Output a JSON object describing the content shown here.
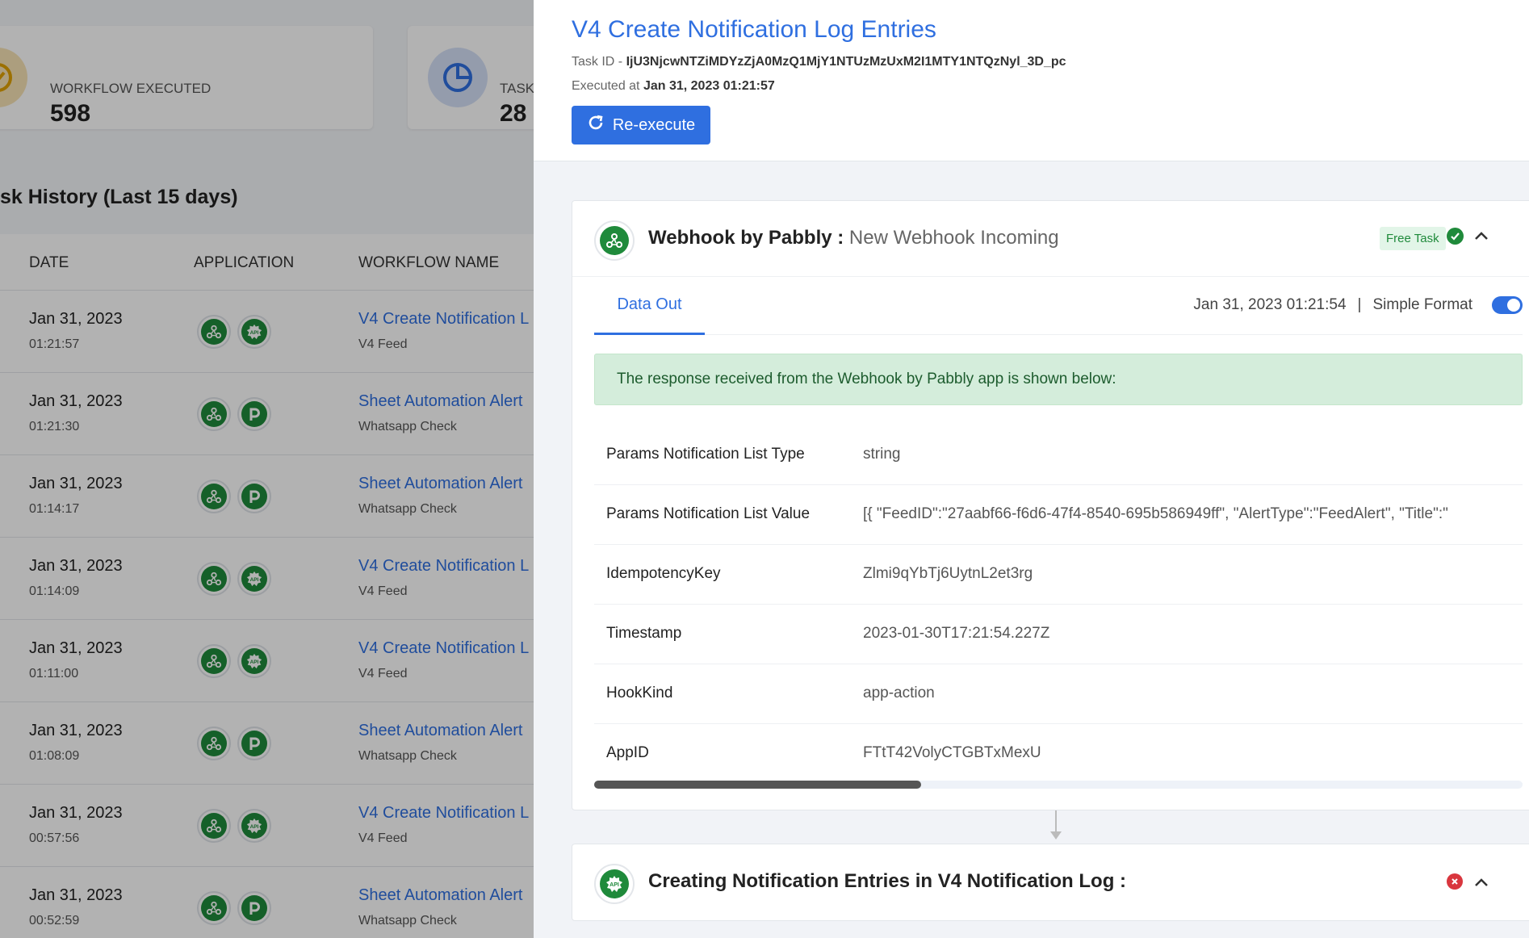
{
  "stats": [
    {
      "label": "WORKFLOW EXECUTED",
      "value": "598",
      "icon": "badge-check-icon"
    },
    {
      "label": "TASK",
      "value": "28",
      "icon": "pie-chart-icon"
    }
  ],
  "history": {
    "title": "sk History (Last 15 days)",
    "columns": [
      "DATE",
      "APPLICATION",
      "WORKFLOW NAME"
    ],
    "rows": [
      {
        "date": "Jan 31, 2023",
        "time": "01:21:57",
        "apps": [
          "webhook",
          "api"
        ],
        "workflow": "V4 Create Notification L",
        "sub": "V4 Feed"
      },
      {
        "date": "Jan 31, 2023",
        "time": "01:21:30",
        "apps": [
          "webhook",
          "pabbly"
        ],
        "workflow": "Sheet Automation Alert",
        "sub": "Whatsapp Check"
      },
      {
        "date": "Jan 31, 2023",
        "time": "01:14:17",
        "apps": [
          "webhook",
          "pabbly"
        ],
        "workflow": "Sheet Automation Alert",
        "sub": "Whatsapp Check"
      },
      {
        "date": "Jan 31, 2023",
        "time": "01:14:09",
        "apps": [
          "webhook",
          "api"
        ],
        "workflow": "V4 Create Notification L",
        "sub": "V4 Feed"
      },
      {
        "date": "Jan 31, 2023",
        "time": "01:11:00",
        "apps": [
          "webhook",
          "api"
        ],
        "workflow": "V4 Create Notification L",
        "sub": "V4 Feed"
      },
      {
        "date": "Jan 31, 2023",
        "time": "01:08:09",
        "apps": [
          "webhook",
          "pabbly"
        ],
        "workflow": "Sheet Automation Alert",
        "sub": "Whatsapp Check"
      },
      {
        "date": "Jan 31, 2023",
        "time": "00:57:56",
        "apps": [
          "webhook",
          "api"
        ],
        "workflow": "V4 Create Notification L",
        "sub": "V4 Feed"
      },
      {
        "date": "Jan 31, 2023",
        "time": "00:52:59",
        "apps": [
          "webhook",
          "pabbly"
        ],
        "workflow": "Sheet Automation Alert",
        "sub": "Whatsapp Check"
      }
    ]
  },
  "panel": {
    "title": "V4 Create Notification Log Entries",
    "task_id_label": "Task ID -",
    "task_id": "IjU3NjcwNTZiMDYzZjA0MzQ1MjY1NTUzMzUxM2I1MTY1NTQzNyl_3D_pc",
    "executed_label": "Executed at",
    "executed_at": "Jan 31, 2023 01:21:57",
    "reexecute_label": "Re-execute"
  },
  "step1": {
    "app": "Webhook by Pabbly :",
    "event": "New Webhook Incoming",
    "badge": "Free Task",
    "tab": "Data Out",
    "timestamp": "Jan 31, 2023 01:21:54",
    "separator": "|",
    "format_label": "Simple Format",
    "notice": "The response received from the Webhook by Pabbly app is shown below:",
    "fields": [
      {
        "key": "Params Notification List Type",
        "value": "string"
      },
      {
        "key": "Params Notification List Value",
        "value": "[{ \"FeedID\":\"27aabf66-f6d6-47f4-8540-695b586949ff\", \"AlertType\":\"FeedAlert\", \"Title\":\""
      },
      {
        "key": "IdempotencyKey",
        "value": "Zlmi9qYbTj6UytnL2et3rg"
      },
      {
        "key": "Timestamp",
        "value": "2023-01-30T17:21:54.227Z"
      },
      {
        "key": "HookKind",
        "value": "app-action"
      },
      {
        "key": "AppID",
        "value": "FTtT42VolyCTGBTxMexU"
      }
    ]
  },
  "step2": {
    "title": "Creating Notification Entries in V4 Notification Log :"
  },
  "colors": {
    "accent": "#2f6fe0",
    "success": "#1f8a3b",
    "error": "#d9363e"
  }
}
